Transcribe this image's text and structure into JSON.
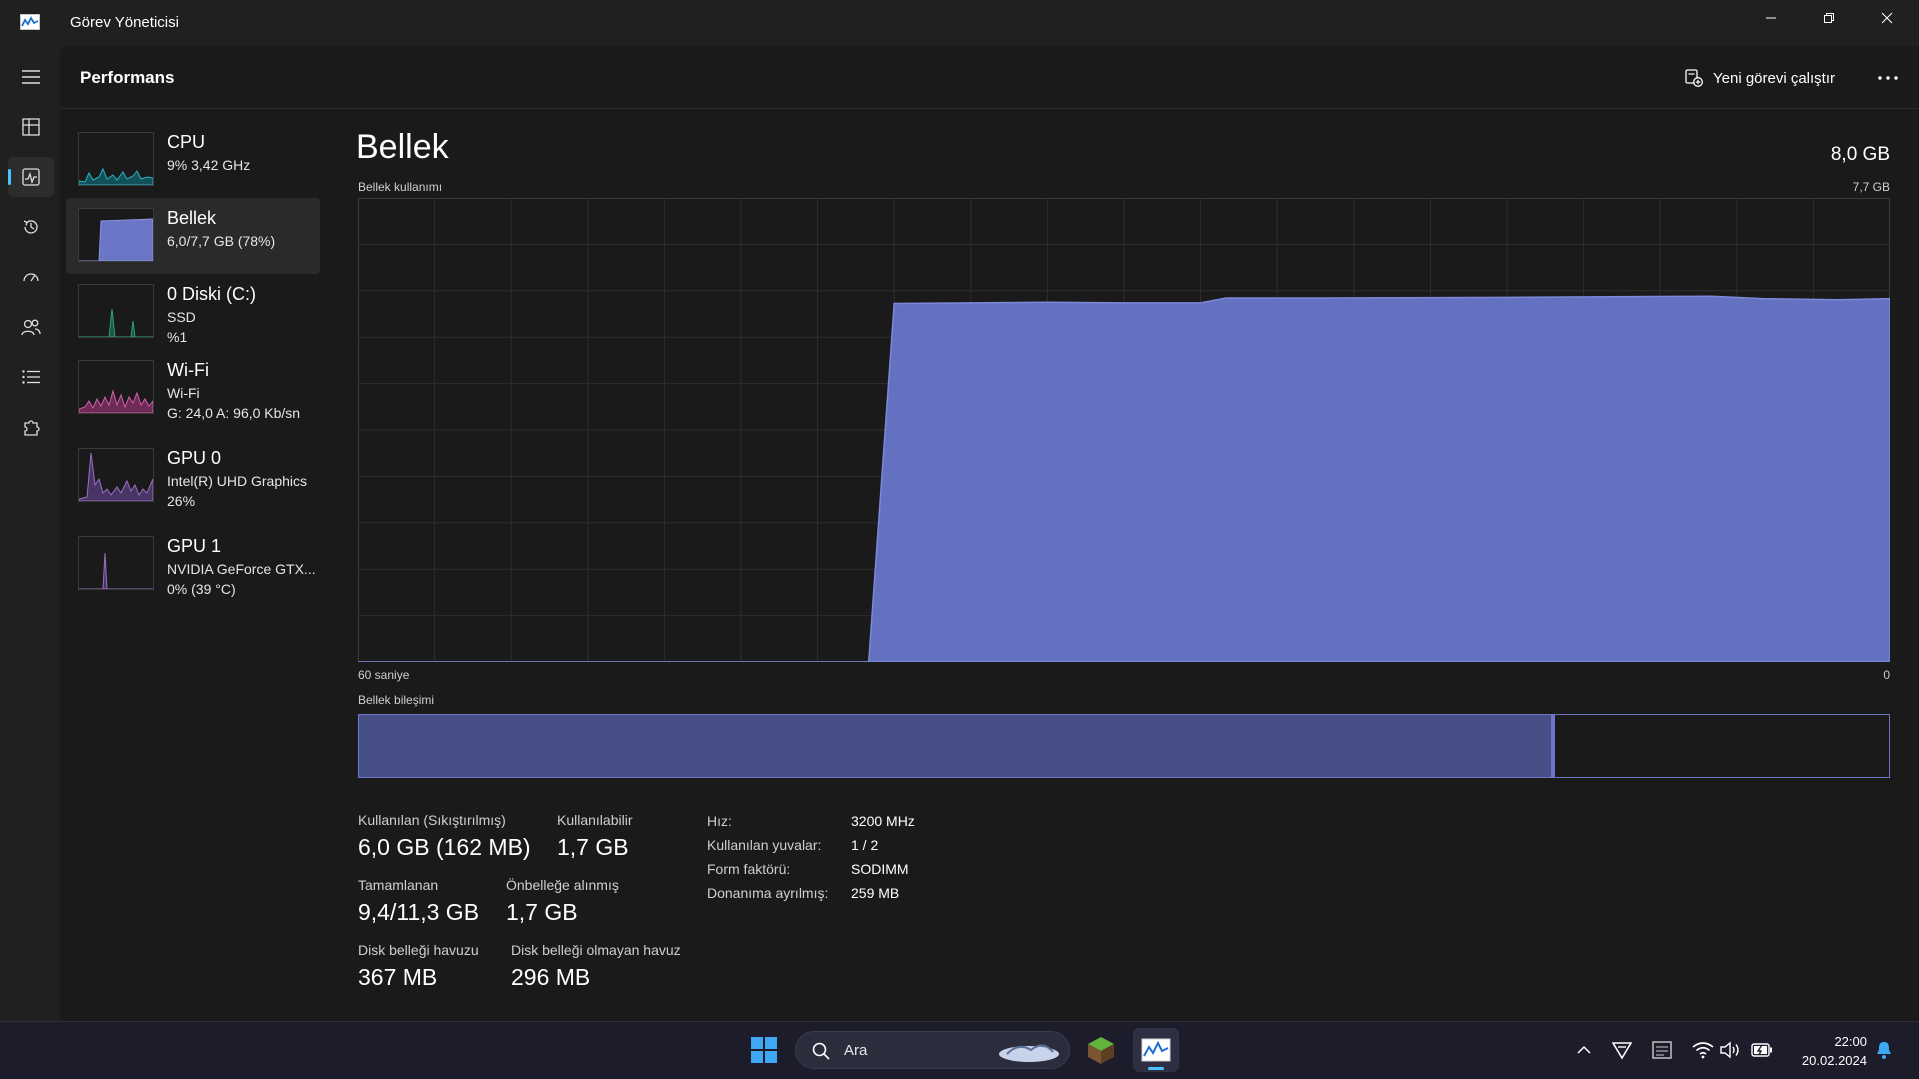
{
  "window": {
    "title": "Görev Yöneticisi"
  },
  "header": {
    "title": "Performans",
    "run_new_task": "Yeni görevi çalıştır"
  },
  "rail": {
    "items": [
      "menu",
      "processes",
      "performance",
      "app-history",
      "startup",
      "users",
      "details",
      "services"
    ],
    "active": "performance"
  },
  "devices": [
    {
      "id": "cpu",
      "name": "CPU",
      "line1": "9% 3,42 GHz",
      "line2": "",
      "color": "#2bb3c0"
    },
    {
      "id": "memory",
      "name": "Bellek",
      "line1": "6,0/7,7 GB (78%)",
      "line2": "",
      "color": "#6b76c7",
      "selected": true
    },
    {
      "id": "disk",
      "name": "0 Diski (C:)",
      "line1": "SSD",
      "line2": "%1",
      "color": "#2ca07e"
    },
    {
      "id": "wifi",
      "name": "Wi-Fi",
      "line1": "Wi-Fi",
      "line2": "G: 24,0 A: 96,0 Kb/sn",
      "color": "#d15ea8"
    },
    {
      "id": "gpu0",
      "name": "GPU 0",
      "line1": "Intel(R) UHD Graphics",
      "line2": "26%",
      "color": "#9a6fc4"
    },
    {
      "id": "gpu1",
      "name": "GPU 1",
      "line1": "NVIDIA GeForce GTX...",
      "line2": "0% (39 °C)",
      "color": "#9a6fc4"
    }
  ],
  "detail": {
    "title": "Bellek",
    "capacity": "8,0 GB",
    "usage_label": "Bellek kullanımı",
    "usage_max": "7,7 GB",
    "axis_left": "60 saniye",
    "axis_right": "0",
    "composition_label": "Bellek bileşimi",
    "composition": {
      "in_use_fraction": 0.779,
      "modified_fraction": 0.002
    },
    "stats": {
      "in_use_label": "Kullanılan (Sıkıştırılmış)",
      "in_use_value": "6,0 GB (162 MB)",
      "available_label": "Kullanılabilir",
      "available_value": "1,7 GB",
      "committed_label": "Tamamlanan",
      "committed_value": "9,4/11,3 GB",
      "cached_label": "Önbelleğe alınmış",
      "cached_value": "1,7 GB",
      "paged_label": "Disk belleği havuzu",
      "paged_value": "367 MB",
      "nonpaged_label": "Disk belleği olmayan havuz",
      "nonpaged_value": "296 MB"
    },
    "specs": [
      {
        "k": "Hız:",
        "v": "3200 MHz"
      },
      {
        "k": "Kullanılan yuvalar:",
        "v": "1 / 2"
      },
      {
        "k": "Form faktörü:",
        "v": "SODIMM"
      },
      {
        "k": "Donanıma ayrılmış:",
        "v": "259 MB"
      }
    ]
  },
  "chart_data": {
    "type": "area",
    "ylabel": "Bellek kullanımı",
    "x_label_left": "60 saniye",
    "x_label_right": "0",
    "x": [
      60,
      40,
      39,
      33,
      30,
      27,
      26,
      22,
      15,
      7,
      5,
      2,
      0
    ],
    "values": [
      0,
      0,
      5.95,
      5.97,
      5.96,
      5.96,
      6.04,
      6.04,
      6.05,
      6.07,
      6.03,
      6.01,
      6.03
    ],
    "ylim": [
      0,
      7.7
    ],
    "color": "#6b76c7",
    "grid": true
  },
  "taskbar": {
    "search_placeholder": "Ara",
    "time": "22:00",
    "date": "20.02.2024"
  }
}
